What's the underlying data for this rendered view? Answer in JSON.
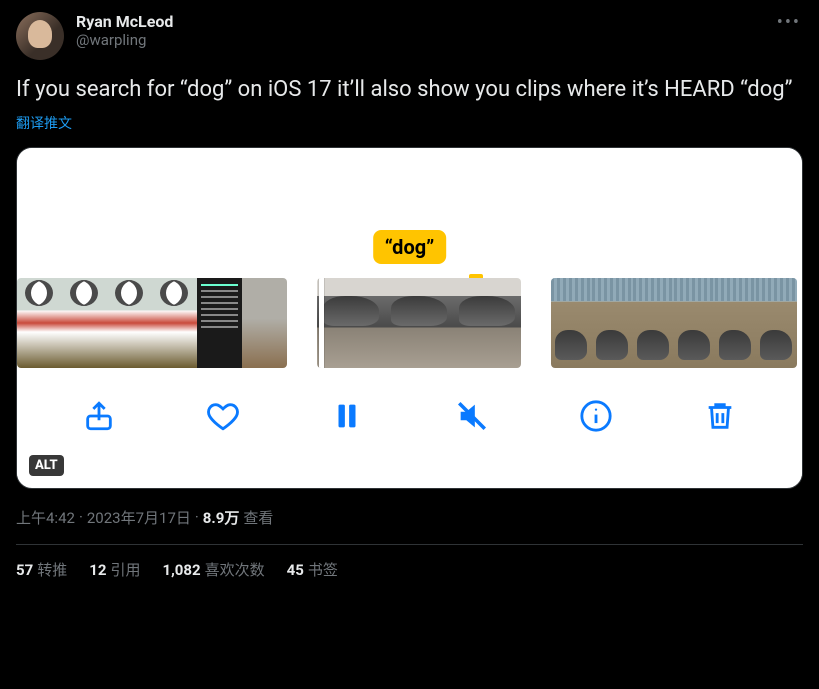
{
  "author": {
    "display_name": "Ryan McLeod",
    "handle": "@warpling"
  },
  "tweet_text": "If you search for “dog” on iOS 17 it’ll also show you clips where it’s HEARD “dog”",
  "translate_label": "翻译推文",
  "media": {
    "caption_tag": "“dog”",
    "alt_badge": "ALT",
    "toolbar_icons": [
      "share",
      "heart",
      "pause",
      "mute",
      "info",
      "trash"
    ]
  },
  "meta": {
    "time": "上午4:42",
    "date": "2023年7月17日",
    "views_count": "8.9万",
    "views_label": "查看"
  },
  "stats": {
    "retweets": {
      "count": "57",
      "label": "转推"
    },
    "quotes": {
      "count": "12",
      "label": "引用"
    },
    "likes": {
      "count": "1,082",
      "label": "喜欢次数"
    },
    "bookmarks": {
      "count": "45",
      "label": "书签"
    }
  }
}
